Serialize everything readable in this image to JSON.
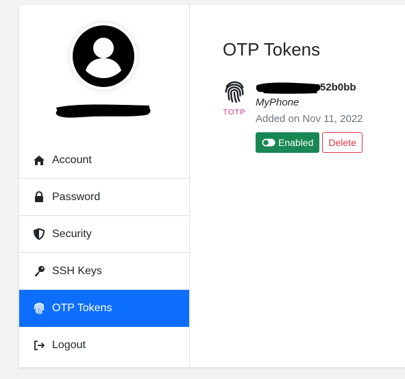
{
  "sidebar": {
    "avatar_icon": "user-circle-icon",
    "username": "",
    "items": [
      {
        "label": "Account",
        "icon": "home-icon",
        "active": false
      },
      {
        "label": "Password",
        "icon": "lock-icon",
        "active": false
      },
      {
        "label": "Security",
        "icon": "shield-icon",
        "active": false
      },
      {
        "label": "SSH Keys",
        "icon": "key-icon",
        "active": false
      },
      {
        "label": "OTP Tokens",
        "icon": "fingerprint-icon",
        "active": true
      },
      {
        "label": "Logout",
        "icon": "logout-icon",
        "active": false
      }
    ]
  },
  "main": {
    "title": "OTP Tokens",
    "token": {
      "icon": "fingerprint-icon",
      "type": "TOTP",
      "id_suffix": "52b0bb",
      "name": "MyPhone",
      "added": "Added on Nov 11, 2022",
      "enabled_label": "Enabled",
      "delete_label": "Delete"
    }
  },
  "colors": {
    "active_nav": "#0d6efd",
    "enabled_button": "#198754",
    "delete_button": "#dc3545",
    "token_type": "#d63384"
  }
}
